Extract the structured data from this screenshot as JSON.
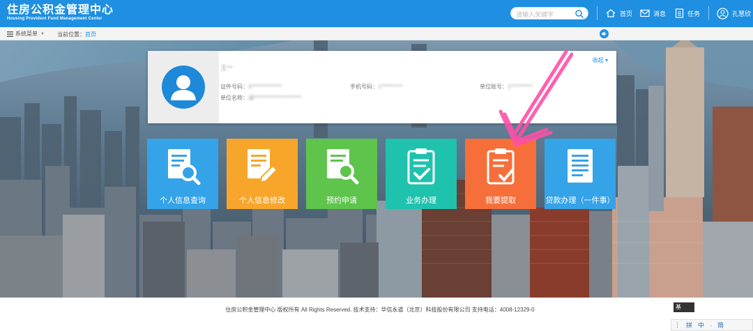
{
  "header": {
    "logo_cn": "住房公积金管理中心",
    "logo_en": "Housing Provident Fund Management Center",
    "search_placeholder": "请输入关键字",
    "nav": [
      {
        "label": "首页",
        "icon": "home-icon"
      },
      {
        "label": "消息",
        "icon": "mail-icon"
      },
      {
        "label": "任务",
        "icon": "task-list-icon"
      }
    ],
    "user_name": "孔慧欣"
  },
  "subbar": {
    "menu_label": "系统菜单",
    "location_label": "当前位置：",
    "location_link": "首页"
  },
  "profile": {
    "name": "王**",
    "collapse_label": "收起",
    "fields": [
      {
        "label": "证件号码：",
        "value": "3**************"
      },
      {
        "label": "手机号码：",
        "value": "1**********"
      },
      {
        "label": "单位账号：",
        "value": "1**********"
      },
      {
        "label": "单位名称：",
        "value": "湖**********************"
      }
    ]
  },
  "tiles": [
    {
      "label": "个人信息查询",
      "color": "#35a3e8",
      "icon": "search-document-icon"
    },
    {
      "label": "个人信息修改",
      "color": "#f7a62b",
      "icon": "edit-document-icon"
    },
    {
      "label": "预约申请",
      "color": "#5ec44c",
      "icon": "appointment-search-icon"
    },
    {
      "label": "业务办理",
      "color": "#1fc2ad",
      "icon": "clipboard-check-icon"
    },
    {
      "label": "我要提取",
      "color": "#f66f3a",
      "icon": "clipboard-withdraw-icon"
    },
    {
      "label": "贷款办理（一件事）",
      "color": "#35a3e8",
      "icon": "loan-document-icon"
    }
  ],
  "footer": {
    "text": "住房公积金管理中心 版权所有 All Rights Reserved. 技术支持：华信永道（北京）科技股份有限公司 支持电话：4008-12329-0"
  },
  "ime": {
    "badge": "基",
    "chars": [
      "拼",
      "中",
      "·",
      "简"
    ]
  },
  "colors": {
    "brand": "#1e8fe1",
    "annotation": "#ff4fa8"
  }
}
